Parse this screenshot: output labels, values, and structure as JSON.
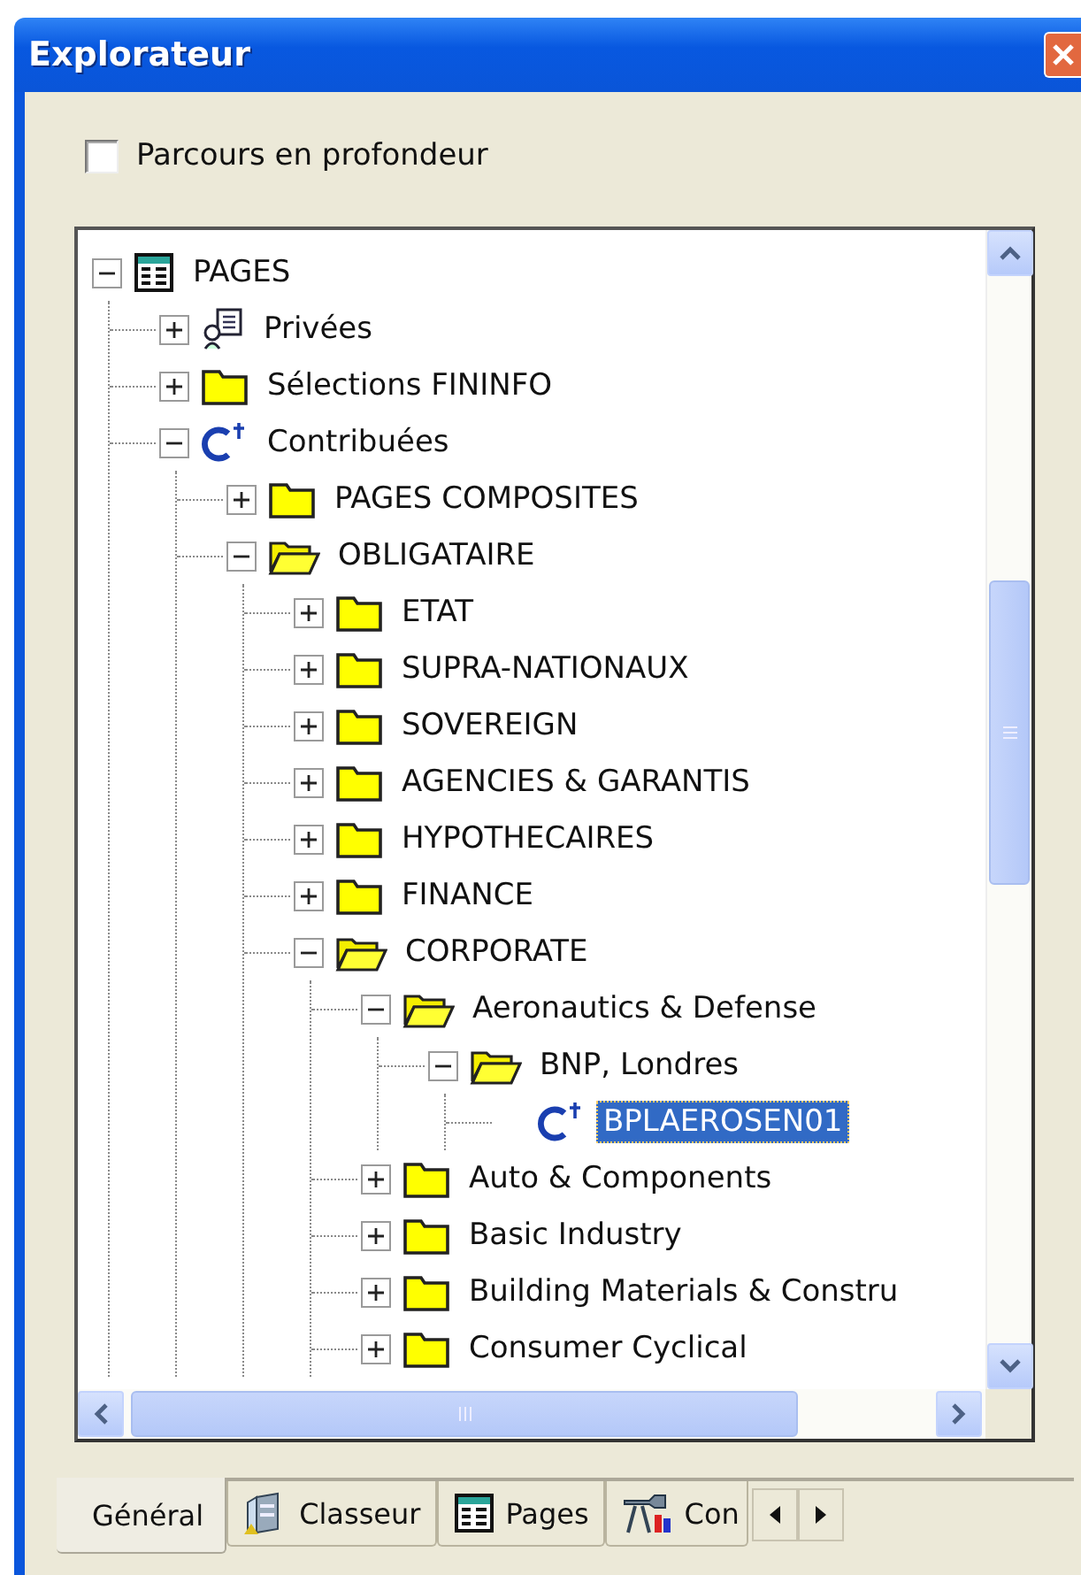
{
  "window": {
    "title": "Explorateur"
  },
  "option": {
    "label": "Parcours en profondeur",
    "checked": false
  },
  "tree": [
    {
      "label": "PAGES",
      "kind": "pages",
      "expanded": true,
      "selected": false,
      "children": [
        {
          "label": "Privées",
          "kind": "private",
          "expanded": false,
          "selected": false
        },
        {
          "label": "Sélections FININFO",
          "kind": "folder",
          "expanded": false,
          "selected": false
        },
        {
          "label": "Contribuées",
          "kind": "contrib",
          "expanded": true,
          "selected": false,
          "children": [
            {
              "label": "PAGES COMPOSITES",
              "kind": "folder",
              "expanded": false,
              "selected": false
            },
            {
              "label": "OBLIGATAIRE",
              "kind": "folder",
              "expanded": true,
              "selected": false,
              "children": [
                {
                  "label": "ETAT",
                  "kind": "folder",
                  "expanded": false,
                  "selected": false
                },
                {
                  "label": "SUPRA-NATIONAUX",
                  "kind": "folder",
                  "expanded": false,
                  "selected": false
                },
                {
                  "label": "SOVEREIGN",
                  "kind": "folder",
                  "expanded": false,
                  "selected": false
                },
                {
                  "label": "AGENCIES & GARANTIS",
                  "kind": "folder",
                  "expanded": false,
                  "selected": false
                },
                {
                  "label": "HYPOTHECAIRES",
                  "kind": "folder",
                  "expanded": false,
                  "selected": false
                },
                {
                  "label": "FINANCE",
                  "kind": "folder",
                  "expanded": false,
                  "selected": false
                },
                {
                  "label": "CORPORATE",
                  "kind": "folder",
                  "expanded": true,
                  "selected": false,
                  "children": [
                    {
                      "label": "Aeronautics & Defense",
                      "kind": "folder",
                      "expanded": true,
                      "selected": false,
                      "children": [
                        {
                          "label": "BNP, Londres",
                          "kind": "folder",
                          "expanded": true,
                          "selected": false,
                          "children": [
                            {
                              "label": "BPLAEROSEN01",
                              "kind": "contrib",
                              "selected": true
                            }
                          ]
                        }
                      ]
                    },
                    {
                      "label": "Auto & Components",
                      "kind": "folder",
                      "expanded": false,
                      "selected": false
                    },
                    {
                      "label": "Basic Industry",
                      "kind": "folder",
                      "expanded": false,
                      "selected": false
                    },
                    {
                      "label": "Building Materials & Constru",
                      "kind": "folder",
                      "expanded": false,
                      "selected": false
                    },
                    {
                      "label": "Consumer Cyclical",
                      "kind": "folder",
                      "expanded": false,
                      "selected": false
                    }
                  ]
                }
              ]
            }
          ]
        }
      ]
    }
  ],
  "tabs": [
    {
      "label": "Général",
      "kind": "plain",
      "selected": true
    },
    {
      "label": "Classeur",
      "kind": "binder",
      "selected": false
    },
    {
      "label": "Pages",
      "kind": "pages",
      "selected": false
    },
    {
      "label": "Con",
      "kind": "tools",
      "selected": false
    }
  ]
}
